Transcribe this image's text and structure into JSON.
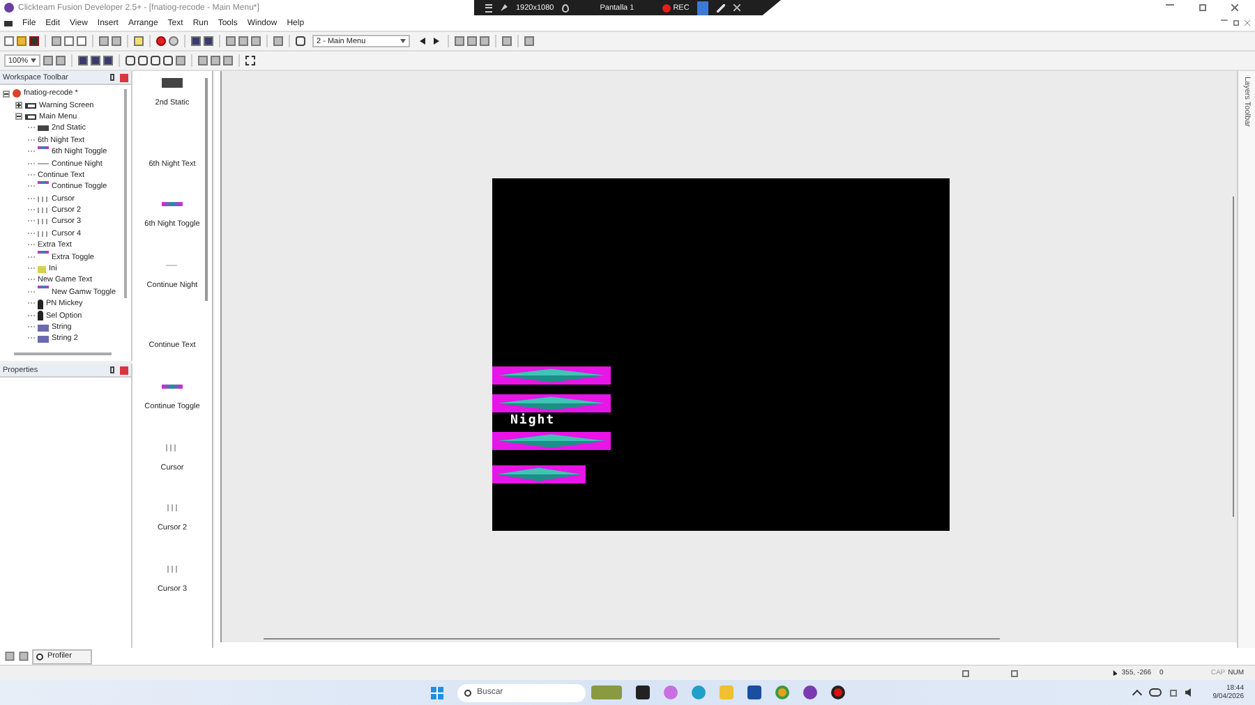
{
  "window": {
    "title": "Clickteam Fusion Developer 2.5+ - [fnatiog-recode - Main Menu*]"
  },
  "recorder_bar": {
    "resolution": "1920x1080",
    "screen": "Pantalla 1",
    "rec": "REC"
  },
  "menu": [
    "File",
    "Edit",
    "View",
    "Insert",
    "Arrange",
    "Text",
    "Run",
    "Tools",
    "Window",
    "Help"
  ],
  "frame_selector": {
    "value": "2 - Main Menu"
  },
  "zoom_selector": {
    "value": "100%"
  },
  "workspace": {
    "title": "Workspace Toolbar",
    "tree": [
      {
        "label": "fnatiog-recode *",
        "kind": "app",
        "expanded": true,
        "children": [
          {
            "label": "Warning Screen",
            "kind": "frame",
            "expanded": false
          },
          {
            "label": "Main Menu",
            "kind": "frame",
            "expanded": true,
            "children": [
              {
                "label": "2nd Static",
                "kind": "backdrop"
              },
              {
                "label": "6th Night Text",
                "kind": "blank"
              },
              {
                "label": "6th Night Toggle",
                "kind": "toggle"
              },
              {
                "label": "Continue Night",
                "kind": "dash"
              },
              {
                "label": "Continue Text",
                "kind": "blank"
              },
              {
                "label": "Continue Toggle",
                "kind": "toggle"
              },
              {
                "label": "Cursor",
                "kind": "cursor"
              },
              {
                "label": "Cursor 2",
                "kind": "cursor"
              },
              {
                "label": "Cursor 3",
                "kind": "cursor"
              },
              {
                "label": "Cursor 4",
                "kind": "cursor"
              },
              {
                "label": "Extra Text",
                "kind": "blank"
              },
              {
                "label": "Extra Toggle",
                "kind": "toggle"
              },
              {
                "label": "Ini",
                "kind": "ini"
              },
              {
                "label": "New Game Text",
                "kind": "blank"
              },
              {
                "label": "New Gamw Toggle",
                "kind": "toggle"
              },
              {
                "label": "PN Mickey",
                "kind": "figure"
              },
              {
                "label": "Sel Option",
                "kind": "figure"
              },
              {
                "label": "String",
                "kind": "string"
              },
              {
                "label": "String 2",
                "kind": "string"
              }
            ]
          }
        ]
      }
    ]
  },
  "properties": {
    "title": "Properties"
  },
  "object_list": [
    {
      "label": "2nd Static",
      "kind": "backdrop"
    },
    {
      "label": "6th Night Text",
      "kind": "blank"
    },
    {
      "label": "6th Night Toggle",
      "kind": "toggle"
    },
    {
      "label": "Continue Night",
      "kind": "dash"
    },
    {
      "label": "Continue Text",
      "kind": "blank"
    },
    {
      "label": "Continue Toggle",
      "kind": "toggle"
    },
    {
      "label": "Cursor",
      "kind": "cursor"
    },
    {
      "label": "Cursor 2",
      "kind": "cursor"
    },
    {
      "label": "Cursor 3",
      "kind": "cursor"
    }
  ],
  "frame_objects": [
    {
      "kind": "toggle",
      "wide": true
    },
    {
      "kind": "toggle",
      "wide": true
    },
    {
      "kind": "text",
      "text": "Night"
    },
    {
      "kind": "toggle",
      "wide": true
    },
    {
      "kind": "toggle",
      "wide": false
    }
  ],
  "layers_toolbar": {
    "title": "Layers Toolbar"
  },
  "bottom_tabs": [
    {
      "label": "Profiler"
    }
  ],
  "status_bar": {
    "coordinates": "355, -266",
    "layer": "0",
    "caps": "CAP",
    "num": "NUM"
  },
  "taskbar": {
    "search_placeholder": "Buscar",
    "time": "18:44",
    "date": "9/04/2026"
  }
}
